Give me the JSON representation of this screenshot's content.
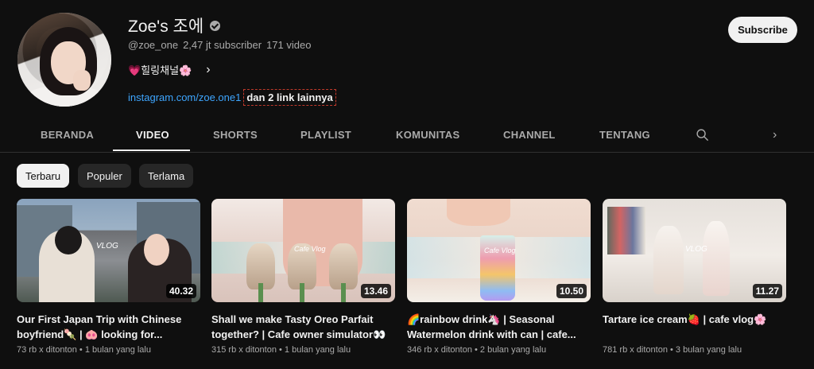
{
  "channel": {
    "name": "Zoe's 조에",
    "handle": "@zoe_one",
    "subscribers": "2,47 jt subscriber",
    "videos": "171 video",
    "tagline": "💗힐링채널🌸",
    "link": "instagram.com/zoe.one1",
    "more_links": "dan 2 link lainnya",
    "subscribe_label": "Subscribe"
  },
  "tabs": [
    {
      "label": "BERANDA"
    },
    {
      "label": "VIDEO"
    },
    {
      "label": "SHORTS"
    },
    {
      "label": "PLAYLIST"
    },
    {
      "label": "KOMUNITAS"
    },
    {
      "label": "CHANNEL"
    },
    {
      "label": "TENTANG"
    }
  ],
  "filters": [
    {
      "label": "Terbaru"
    },
    {
      "label": "Populer"
    },
    {
      "label": "Terlama"
    }
  ],
  "videos": [
    {
      "title": "Our First Japan Trip with Chinese boyfriend🍡 | 🐽 looking for...",
      "duration": "40.32",
      "views": "73 rb x ditonton",
      "age": "1 bulan yang lalu",
      "thumb_text": "VLOG"
    },
    {
      "title": "Shall we make Tasty Oreo Parfait together? | Cafe owner simulator👀",
      "duration": "13.46",
      "views": "315 rb x ditonton",
      "age": "1 bulan yang lalu",
      "thumb_text": "Cafe Vlog"
    },
    {
      "title": "🌈rainbow drink🦄 | Seasonal Watermelon drink with can | cafe...",
      "duration": "10.50",
      "views": "346 rb x ditonton",
      "age": "2 bulan yang lalu",
      "thumb_text": "Cafe Vlog"
    },
    {
      "title": "Tartare ice cream🍓 | cafe vlog🌸",
      "duration": "11.27",
      "views": "781 rb x ditonton",
      "age": "3 bulan yang lalu",
      "thumb_text": "VLOG"
    }
  ],
  "icons": {
    "verified": "verified-check-icon",
    "search": "search-icon",
    "next": "chevron-right-icon"
  }
}
